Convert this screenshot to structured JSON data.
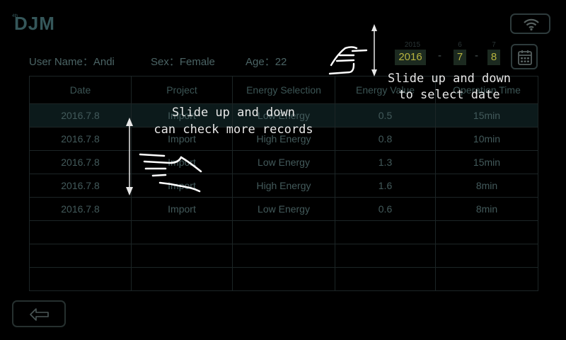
{
  "header": {
    "logo_text": "DJM",
    "logo_superscript": "4th"
  },
  "user": {
    "name_label": "User Name：Andi",
    "sex_label": "Sex：Female",
    "age_label": "Age：22"
  },
  "date_picker": {
    "year": "2016",
    "year_prev": "2015",
    "month": "7",
    "month_prev": "6",
    "day": "8",
    "day_prev": "7",
    "separator": "-"
  },
  "table": {
    "columns": [
      "Date",
      "Project",
      "Energy Selection",
      "Energy Value",
      "Operation Time"
    ],
    "rows": [
      [
        "2016.7.8",
        "Import",
        "Low Energy",
        "0.5",
        "15min"
      ],
      [
        "2016.7.8",
        "Import",
        "High Energy",
        "0.8",
        "10min"
      ],
      [
        "2016.7.8",
        "Import",
        "Low Energy",
        "1.3",
        "15min"
      ],
      [
        "2016.7.8",
        "Import",
        "High Energy",
        "1.6",
        "8min"
      ],
      [
        "2016.7.8",
        "Import",
        "Low Energy",
        "0.6",
        "8min"
      ],
      [
        "",
        "",
        "",
        "",
        ""
      ],
      [
        "",
        "",
        "",
        "",
        ""
      ],
      [
        "",
        "",
        "",
        "",
        ""
      ]
    ]
  },
  "tips": {
    "records_line1": "Slide up and down",
    "records_line2": "can check more records",
    "date_line1": "Slide up and down",
    "date_line2": "to select date"
  },
  "icons": {
    "wifi": "wifi-icon",
    "calendar": "calendar-icon",
    "back": "back-arrow-icon",
    "hand": "hand-pointer-icon",
    "swipe_arrow": "up-down-arrow-icon"
  },
  "colors": {
    "background": "#000000",
    "tip_text": "#e8e8e8",
    "date_highlight": "#b7b33f"
  }
}
